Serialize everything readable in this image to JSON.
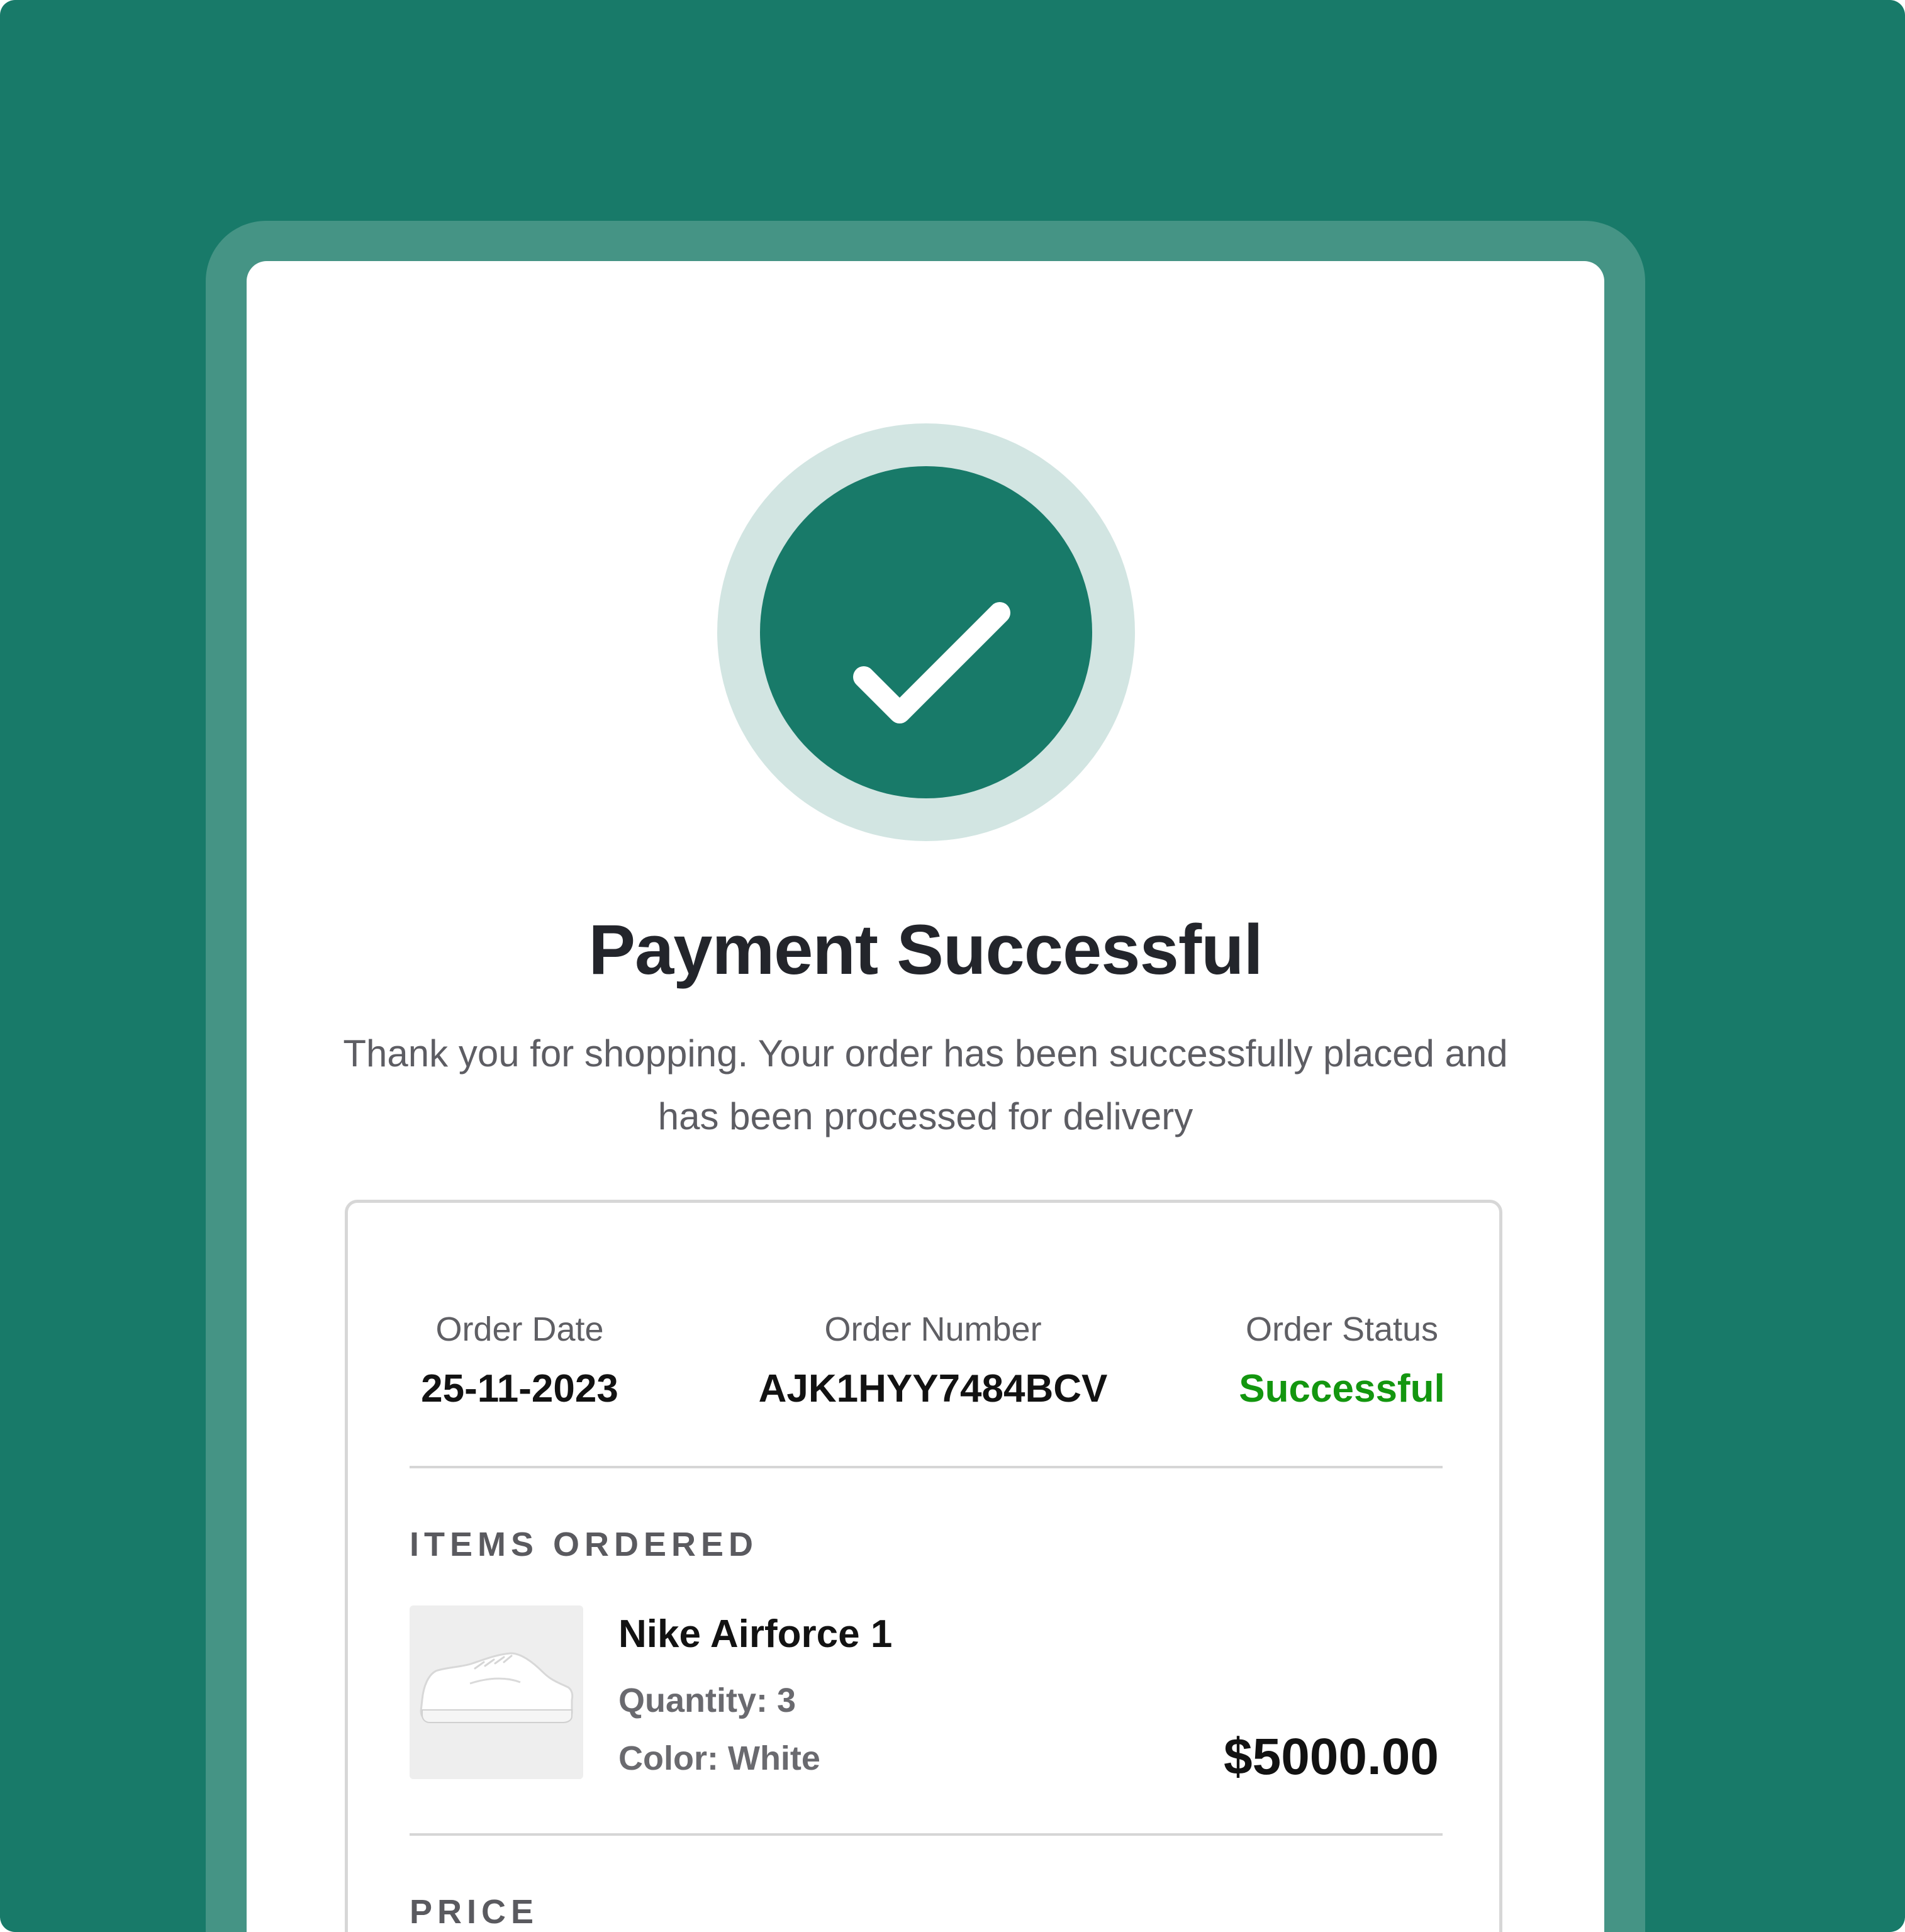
{
  "colors": {
    "background": "#187a69",
    "frame": "#459485",
    "check_ring": "#d2e5e2",
    "check_fill": "#187a69",
    "status_success": "#13960f"
  },
  "icons": {
    "status": "checkmark-icon",
    "product_image": "sneaker-image"
  },
  "header": {
    "title": "Payment Successful",
    "message": "Thank you for shopping. Your order has been successfully placed and has been processed for delivery"
  },
  "order": {
    "date_label": "Order Date",
    "date_value": "25-11-2023",
    "number_label": "Order Number",
    "number_value": "AJK1HYY7484BCV",
    "status_label": "Order Status",
    "status_value": "Successful"
  },
  "items_section": {
    "heading": "ITEMS ORDERED",
    "items": [
      {
        "name": "Nike Airforce 1",
        "quantity": "Quantity: 3",
        "color": "Color: White",
        "price": "$5000.00"
      }
    ]
  },
  "price_section": {
    "heading": "PRICE"
  }
}
